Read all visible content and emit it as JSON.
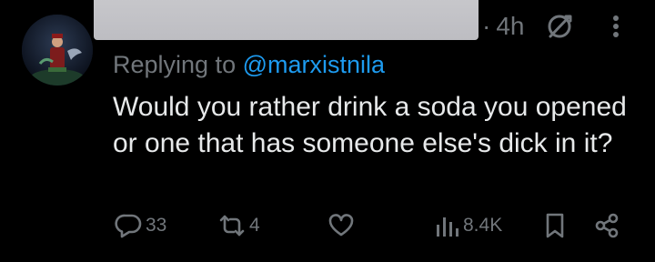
{
  "tweet": {
    "time_sep": "·",
    "timestamp": "4h",
    "replying_prefix": "Replying to ",
    "replying_handle": "@marxistnila",
    "text": "Would you rather drink a soda you opened or one that has someone else's dick in it?"
  },
  "icons": {
    "avatar": "profile-avatar",
    "grok": "grok-icon",
    "more": "more-vertical-icon",
    "reply": "reply-icon",
    "repost": "repost-icon",
    "like": "heart-icon",
    "views": "views-chart-icon",
    "bookmark": "bookmark-icon",
    "share": "share-icon"
  },
  "actions": {
    "replies": "33",
    "reposts": "4",
    "views": "8.4K"
  },
  "colors": {
    "background": "#000000",
    "text": "#e7e9ea",
    "muted": "#71767b",
    "link": "#1d9bf0",
    "redaction": "#c4c4c8"
  }
}
